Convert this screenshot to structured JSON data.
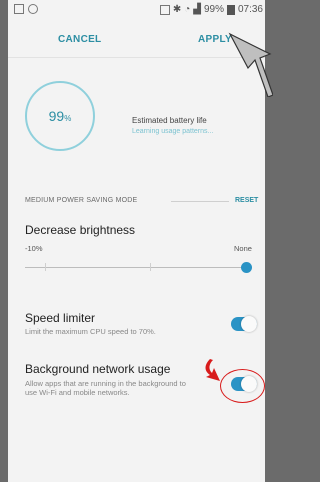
{
  "status_bar": {
    "battery_text": "99%",
    "time": "07:36"
  },
  "header": {
    "cancel_label": "CANCEL",
    "apply_label": "APPLY"
  },
  "battery": {
    "percent": "99",
    "percent_sign": "%",
    "estimate_label": "Estimated battery life",
    "estimate_value": "Learning usage patterns..."
  },
  "section": {
    "title": "MEDIUM POWER SAVING MODE",
    "reset_label": "RESET"
  },
  "brightness": {
    "title": "Decrease brightness",
    "min_label": "-10%",
    "max_label": "None",
    "level": 1.0
  },
  "speed_limiter": {
    "title": "Speed limiter",
    "description": "Limit the maximum CPU speed to 70%.",
    "enabled": true
  },
  "background_network": {
    "title": "Background network usage",
    "description": "Allow apps that are running in the background to use Wi-Fi and mobile networks.",
    "enabled": true
  },
  "colors": {
    "accent": "#2c8ea3",
    "toggle": "#2a93c5",
    "annotation": "#d81b1b"
  }
}
